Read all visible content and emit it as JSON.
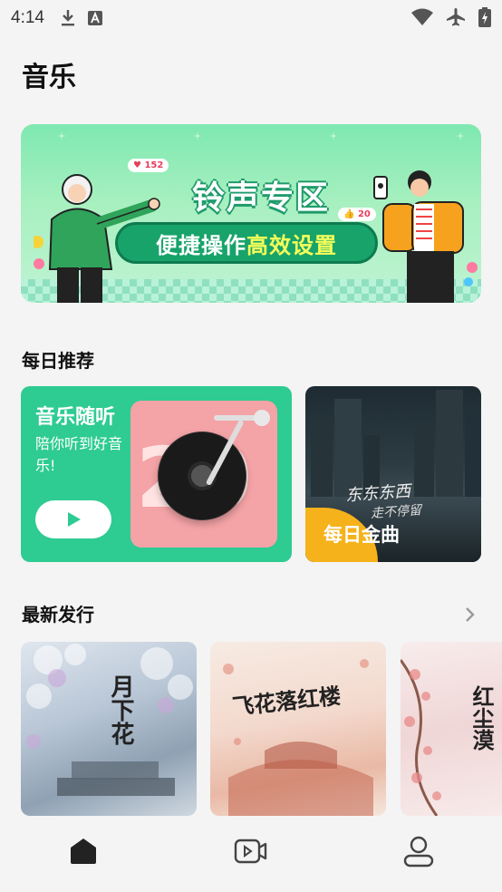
{
  "status_bar": {
    "time": "4:14"
  },
  "page": {
    "title": "音乐"
  },
  "banner": {
    "headline": "铃声专区",
    "pill_prefix": "便捷操作",
    "pill_highlight": "高效设置",
    "like_badge_left": "152",
    "like_badge_right": "20"
  },
  "daily": {
    "section_title": "每日推荐",
    "listen_card": {
      "title": "音乐随听",
      "subtitle": "陪你听到好音乐!",
      "cover_number": "20"
    },
    "gold_card": {
      "label": "每日金曲",
      "script_line1": "东东东西",
      "script_line2": "走不停留"
    }
  },
  "new_releases": {
    "section_title": "最新发行",
    "albums": [
      {
        "cover_text": "月下花"
      },
      {
        "cover_text": "飞花落红楼"
      },
      {
        "cover_text": "红尘漠"
      }
    ]
  },
  "colors": {
    "accent_green": "#2ecb92",
    "gold": "#f6b21a",
    "background": "#f4f4f4"
  },
  "icons": {
    "nav": [
      "home-icon",
      "video-icon",
      "profile-icon"
    ]
  }
}
